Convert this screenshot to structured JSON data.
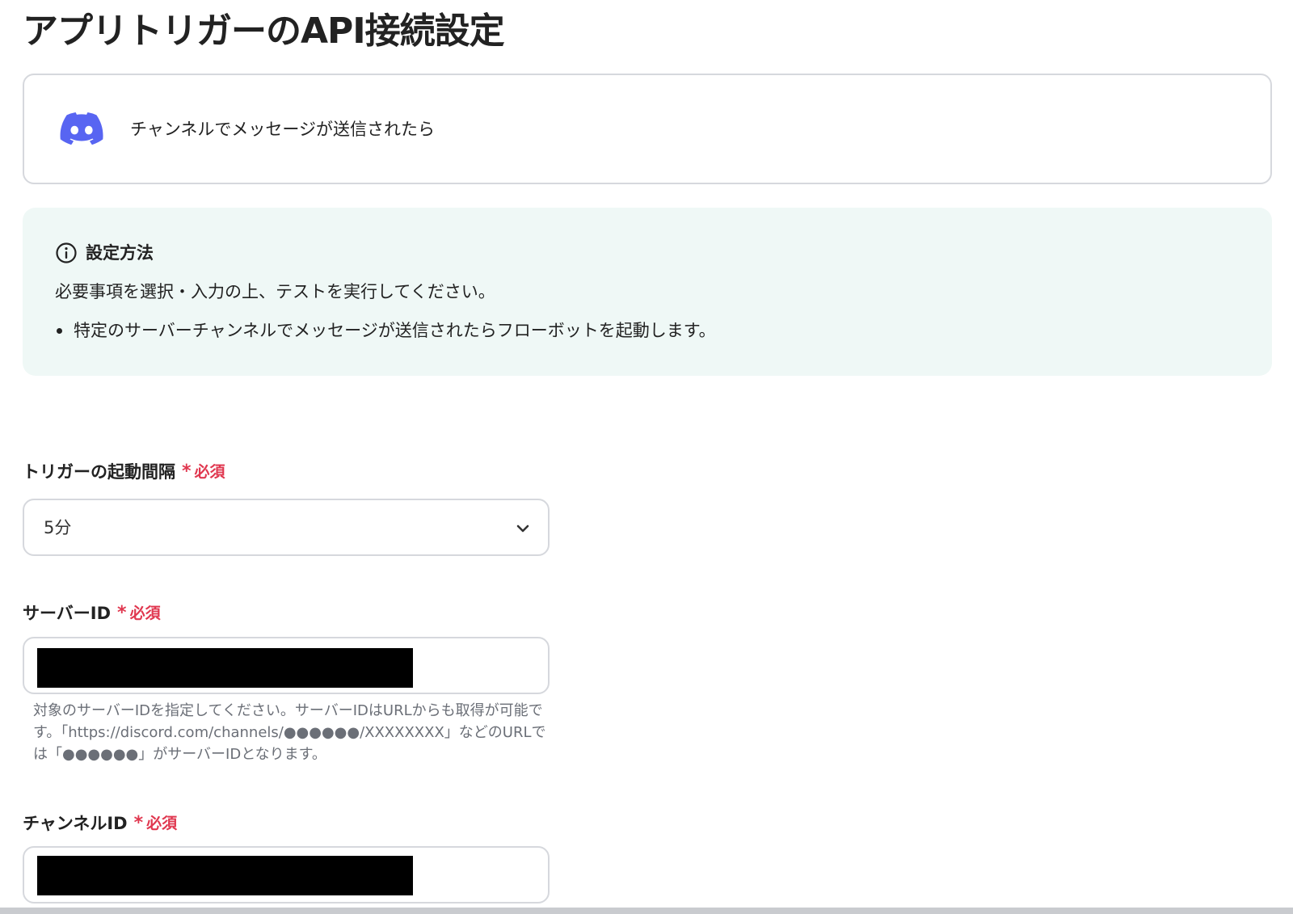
{
  "page": {
    "title": "アプリトリガーのAPI接続設定"
  },
  "app_card": {
    "icon": "discord-icon",
    "label": "チャンネルでメッセージが送信されたら"
  },
  "info": {
    "icon": "info-icon",
    "title": "設定方法",
    "text": "必要事項を選択・入力の上、テストを実行してください。",
    "bullets": [
      "特定のサーバーチャンネルでメッセージが送信されたらフローボットを起動します。"
    ]
  },
  "fields": {
    "interval": {
      "label": "トリガーの起動間隔",
      "asterisk": "*",
      "required": "必須",
      "value": "5分"
    },
    "server_id": {
      "label": "サーバーID",
      "asterisk": "*",
      "required": "必須",
      "help": "対象のサーバーIDを指定してください。サーバーIDはURLからも取得が可能です。「https://discord.com/channels/●●●●●●/XXXXXXXX」などのURLでは「●●●●●●」がサーバーIDとなります。"
    },
    "channel_id": {
      "label": "チャンネルID",
      "asterisk": "*",
      "required": "必須"
    }
  },
  "colors": {
    "required": "#e0374f",
    "discord": "#5865f2",
    "info_bg": "#eff8f6",
    "border": "#d6d8dd"
  }
}
